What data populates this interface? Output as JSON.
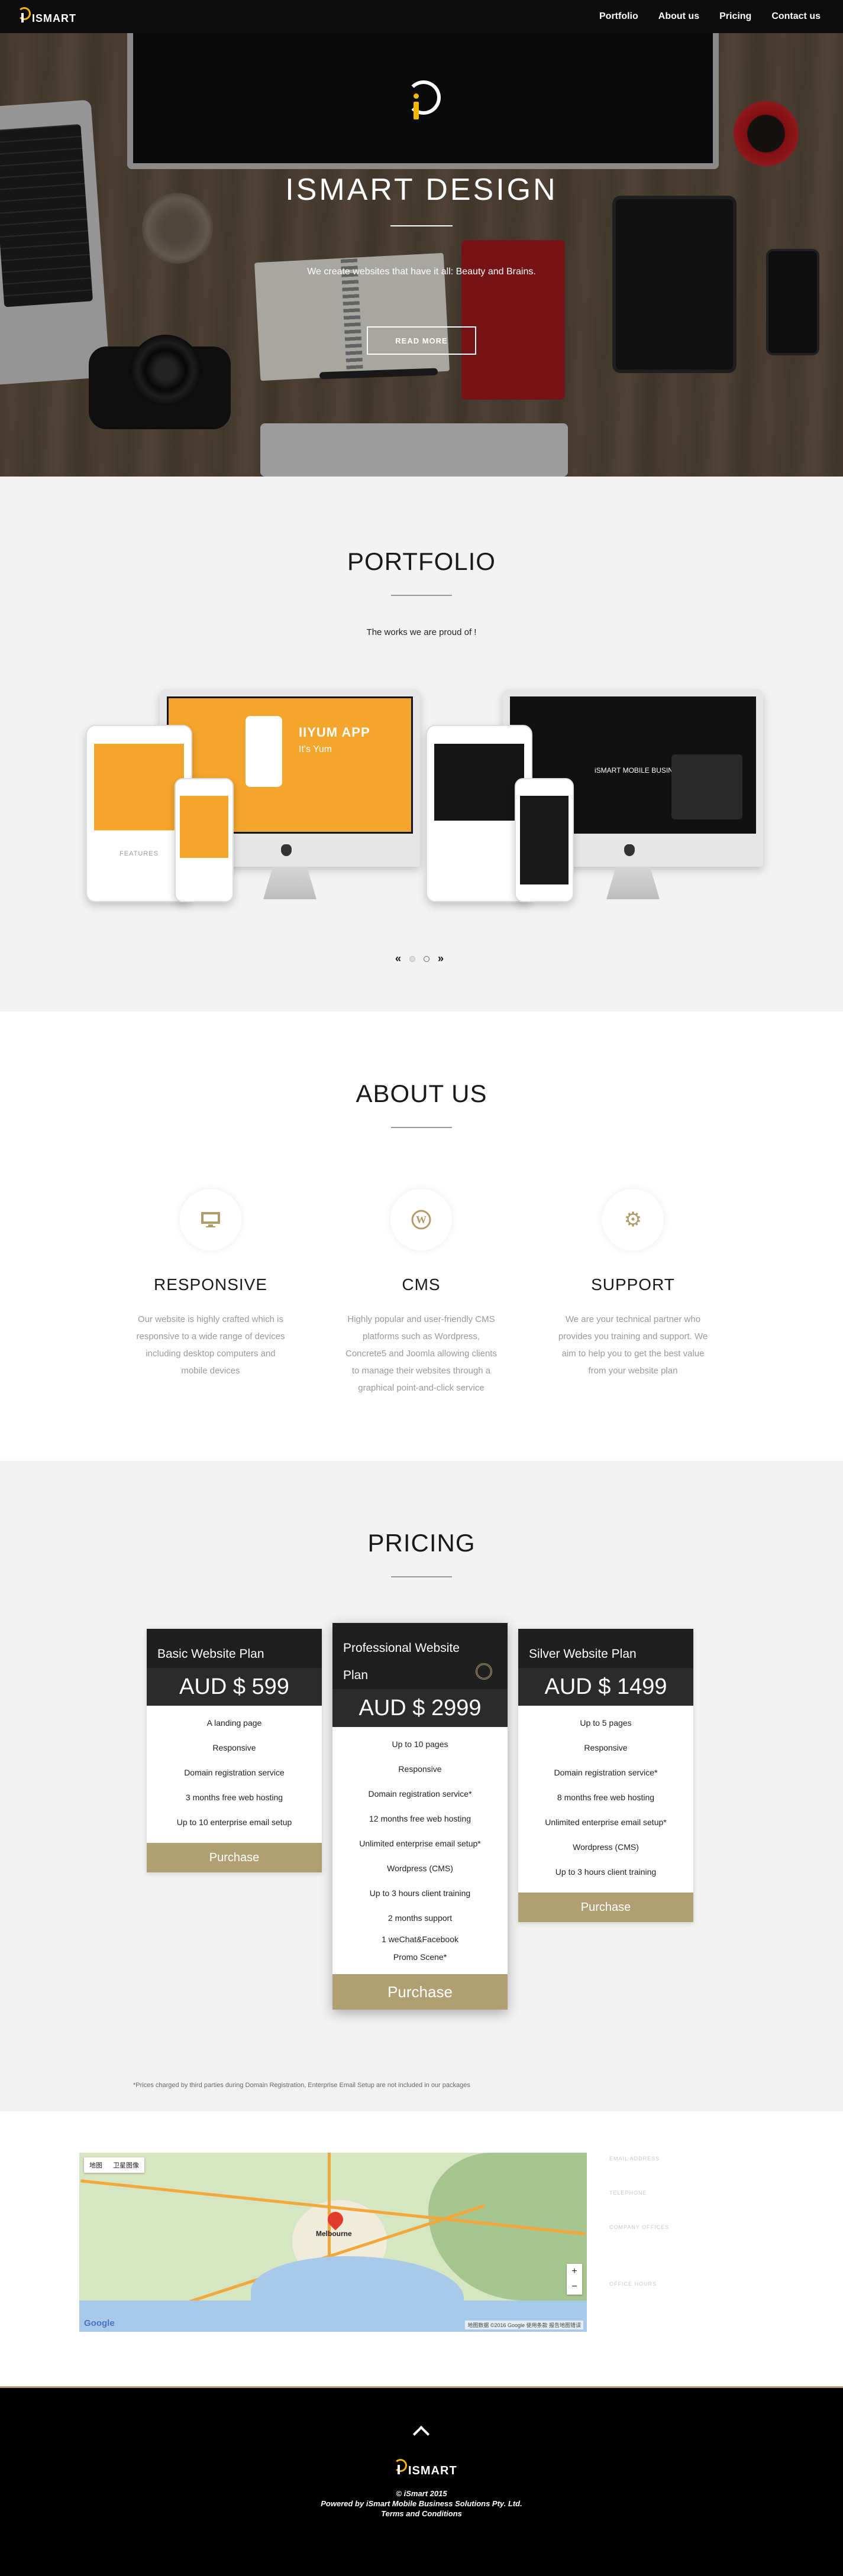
{
  "brand": {
    "name": "ISMART"
  },
  "nav": {
    "items": [
      "Portfolio",
      "About us",
      "Pricing",
      "Contact us"
    ]
  },
  "hero": {
    "title": "ISMART DESIGN",
    "subtitle": "We create websites that have it all: Beauty and Brains.",
    "button": "READ MORE"
  },
  "portfolio": {
    "title": "PORTFOLIO",
    "subtitle": "The works we are proud of !",
    "items": [
      {
        "app_title": "IIYUM APP",
        "app_sub": "It's Yum",
        "label": "FEATURES"
      },
      {
        "app_title": "iSMART MOBILE BUSINESS SOLUTIONS"
      }
    ],
    "carousel": {
      "prev": "«",
      "next": "»",
      "active": 1,
      "count": 2
    }
  },
  "about": {
    "title": "ABOUT US",
    "features": [
      {
        "icon": "monitor-icon",
        "glyph": "▭",
        "title": "RESPONSIVE",
        "text": "Our website is highly crafted which is responsive to a wide range of devices including desktop computers and mobile devices"
      },
      {
        "icon": "wordpress-icon",
        "glyph": "W",
        "title": "CMS",
        "text": "Highly popular and user-friendly CMS platforms such as Wordpress, Concrete5 and Joomla allowing clients to manage their websites through a graphical point-and-click service"
      },
      {
        "icon": "gear-icon",
        "glyph": "⚙",
        "title": "SUPPORT",
        "text": "We are your technical partner who provides you training and support. We aim to help you to get the best value from your website plan"
      }
    ]
  },
  "pricing": {
    "title": "PRICING",
    "plans": [
      {
        "name": "Basic Website Plan",
        "price": "AUD $ 599",
        "features": [
          "A landing page",
          "Responsive",
          "Domain registration service",
          "3 months free web hosting",
          "Up to 10 enterprise email setup"
        ],
        "button": "Purchase"
      },
      {
        "name": "Professional Website Plan",
        "price": "AUD $ 2999",
        "features": [
          "Up to 10 pages",
          "Responsive",
          "Domain registration service*",
          "12 months free web hosting",
          "Unlimited enterprise email setup*",
          "Wordpress (CMS)",
          "Up to 3 hours client training",
          "2 months support",
          "1 weChat&Facebook Promo Scene*"
        ],
        "button": "Purchase"
      },
      {
        "name": "Silver Website Plan",
        "price": "AUD $ 1499",
        "features": [
          "Up to 5 pages",
          "Responsive",
          "Domain registration service*",
          "8 months free web hosting",
          "Unlimited enterprise email setup*",
          "Wordpress (CMS)",
          "Up to 3 hours client training"
        ],
        "button": "Purchase"
      }
    ],
    "note": "*Prices charged by third parties during Domain Registration, Enterprise Email Setup are not included in our packages"
  },
  "contact": {
    "map": {
      "type_options": [
        "地图",
        "卫星图像"
      ],
      "marker_label": "Melbourne",
      "google": "Google",
      "attribution": "地图数据 ©2016 Google 使用条款 报告地图错误",
      "zoom_in": "+",
      "zoom_out": "−"
    },
    "labels": [
      "EMAIL ADDRESS",
      "TELEPHONE",
      "COMPANY OFFICES",
      "OFFICE HOURS"
    ]
  },
  "footer": {
    "copyright": "© iSmart 2015",
    "powered": "Powered by iSmart Mobile Business Solutions Pty. Ltd.",
    "terms": "Terms and Conditions"
  },
  "colors": {
    "accent": "#b09f72",
    "logo_yellow": "#f2b705",
    "app_orange": "#f4a52c"
  }
}
